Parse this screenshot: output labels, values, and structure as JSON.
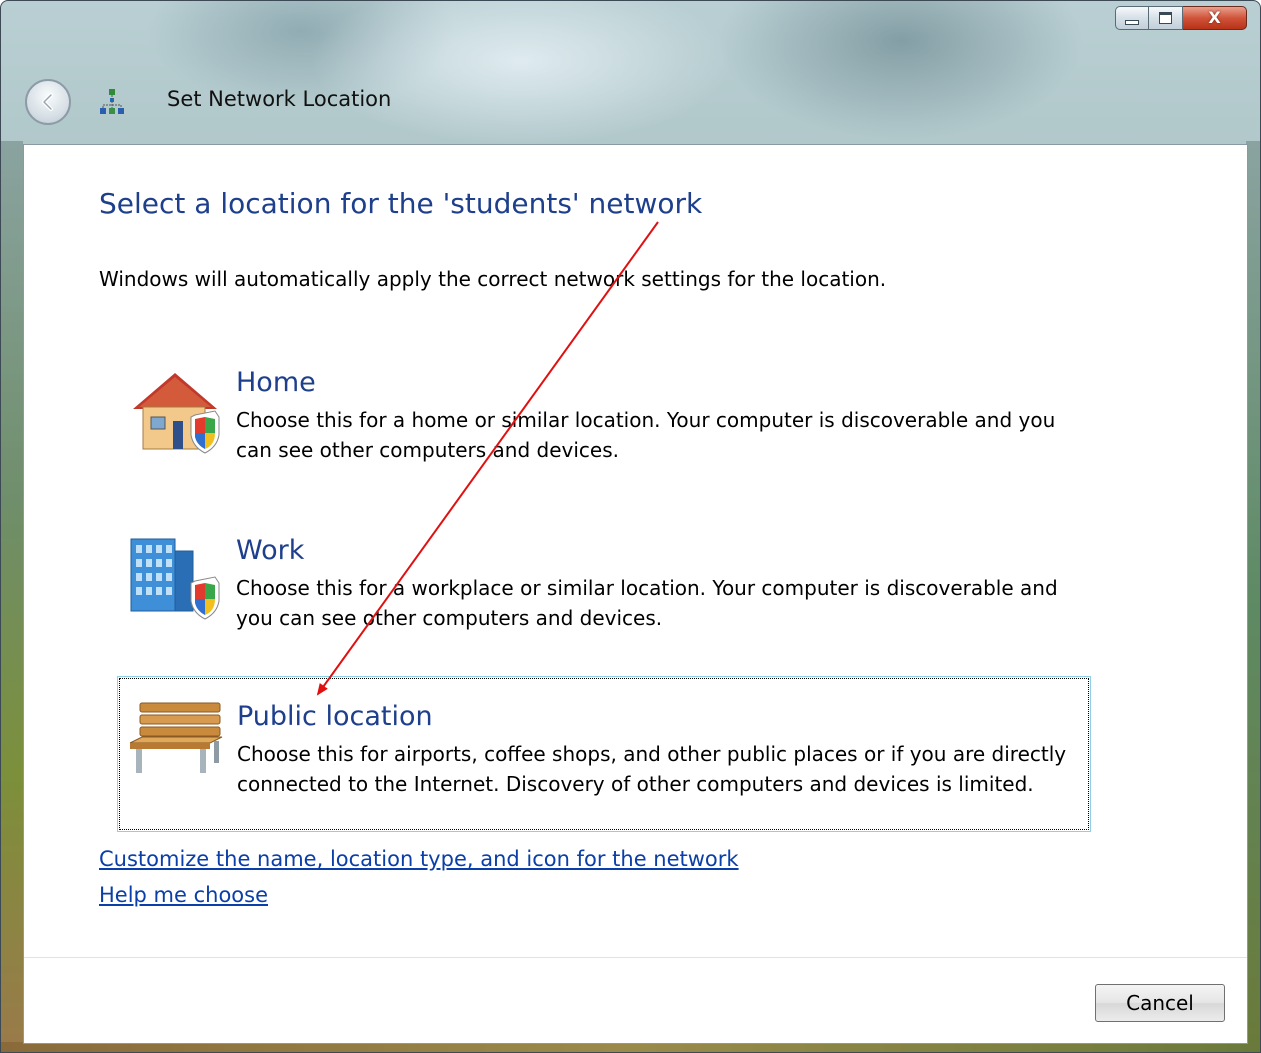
{
  "window": {
    "title": "Set Network Location",
    "close_glyph": "X"
  },
  "main": {
    "heading": "Select a location for the 'students' network",
    "subtext": "Windows will automatically apply the correct network settings for the location."
  },
  "options": [
    {
      "title": "Home",
      "description": "Choose this for a home or similar location. Your computer is discoverable and you can see other computers and devices.",
      "icon": "house-shield-icon"
    },
    {
      "title": "Work",
      "description": "Choose this for a workplace or similar location. Your computer is discoverable and you can see other computers and devices.",
      "icon": "office-building-shield-icon"
    },
    {
      "title": "Public location",
      "description": "Choose this for airports, coffee shops, and other public places or if you are directly connected to the Internet. Discovery of other computers and devices is limited.",
      "icon": "park-bench-icon",
      "focused": true
    }
  ],
  "links": {
    "customize": "Customize the name, location type, and icon for the network",
    "help": "Help me choose"
  },
  "footer": {
    "cancel_label": "Cancel"
  },
  "colors": {
    "heading": "#1e3f8c",
    "link": "#0a3ea8",
    "annotation_arrow": "#e01010"
  }
}
